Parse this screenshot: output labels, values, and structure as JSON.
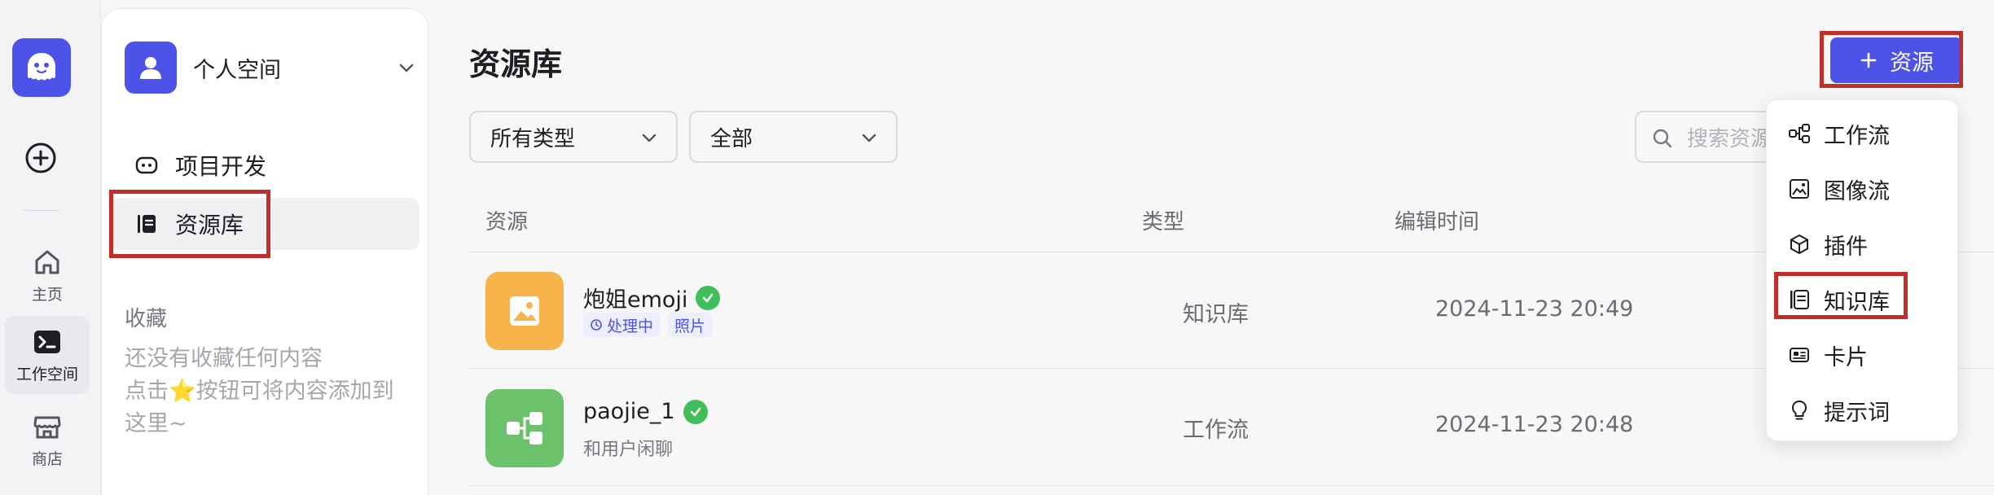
{
  "rail": {
    "logo": "coze-logo-icon",
    "items": [
      {
        "label": "主页",
        "icon": "home-icon"
      },
      {
        "label": "工作空间",
        "icon": "terminal-icon"
      },
      {
        "label": "商店",
        "icon": "store-icon"
      }
    ]
  },
  "sidebar": {
    "space_name": "个人空间",
    "nav": [
      {
        "label": "项目开发",
        "icon": "bot-icon"
      },
      {
        "label": "资源库",
        "icon": "library-icon"
      }
    ],
    "favorites_title": "收藏",
    "favorites_empty_line1": "还没有收藏任何内容",
    "favorites_empty_line2a": "点击",
    "favorites_empty_line2b": "按钮可将内容添加到",
    "favorites_empty_line3": "这里~"
  },
  "main": {
    "title": "资源库",
    "add_button": "资源",
    "filter_type": "所有类型",
    "filter_scope": "全部",
    "search_placeholder": "搜索资源",
    "columns": [
      "资源",
      "类型",
      "编辑时间"
    ],
    "rows": [
      {
        "name": "炮姐emoji",
        "tags": [
          "处理中",
          "照片"
        ],
        "type": "知识库",
        "time": "2024-11-23 20:49",
        "thumb_color": "#f5b349",
        "icon": "image-icon"
      },
      {
        "name": "paojie_1",
        "desc": "和用户闲聊",
        "type": "工作流",
        "time": "2024-11-23 20:48",
        "thumb_color": "#6cc16b",
        "icon": "workflow-icon"
      }
    ]
  },
  "menu": {
    "items": [
      {
        "label": "工作流",
        "icon": "workflow-icon"
      },
      {
        "label": "图像流",
        "icon": "imageflow-icon"
      },
      {
        "label": "插件",
        "icon": "plugin-icon"
      },
      {
        "label": "知识库",
        "icon": "knowledge-icon"
      },
      {
        "label": "卡片",
        "icon": "card-icon"
      },
      {
        "label": "提示词",
        "icon": "prompt-icon"
      }
    ]
  },
  "colors": {
    "accent": "#4d53e8",
    "highlight": "#c0302a",
    "success": "#3fbf5a"
  }
}
